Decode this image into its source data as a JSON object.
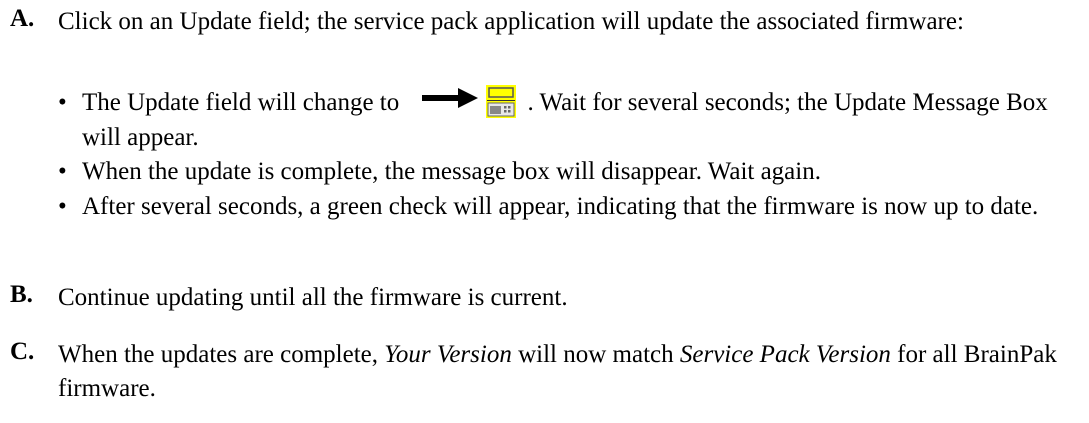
{
  "steps": {
    "a": {
      "letter": "A.",
      "text": "Click on an Update field; the service pack application will update the associated firmware:"
    },
    "a_bullets": {
      "b1_pre": "The Update field will change to",
      "b1_post": ".  Wait for several seconds; the Update Message Box will appear.",
      "b2": "When the update is complete, the message box will disappear.  Wait again.",
      "b3": "After several seconds, a green check will appear, indicating that the firmware is now up to date."
    },
    "b": {
      "letter": "B.",
      "text": "Continue updating until all the firmware is current."
    },
    "c": {
      "letter": "C.",
      "pre": "When the updates are complete, ",
      "em1": "Your Version",
      "mid": " will now match ",
      "em2": "Service Pack Version",
      "post": " for all BrainPak firmware."
    }
  },
  "icons": {
    "arrow": "right-arrow-icon",
    "update_status": "update-in-progress-icon",
    "update_icon_bg": "#ffff00",
    "update_icon_panel": "#888888"
  }
}
